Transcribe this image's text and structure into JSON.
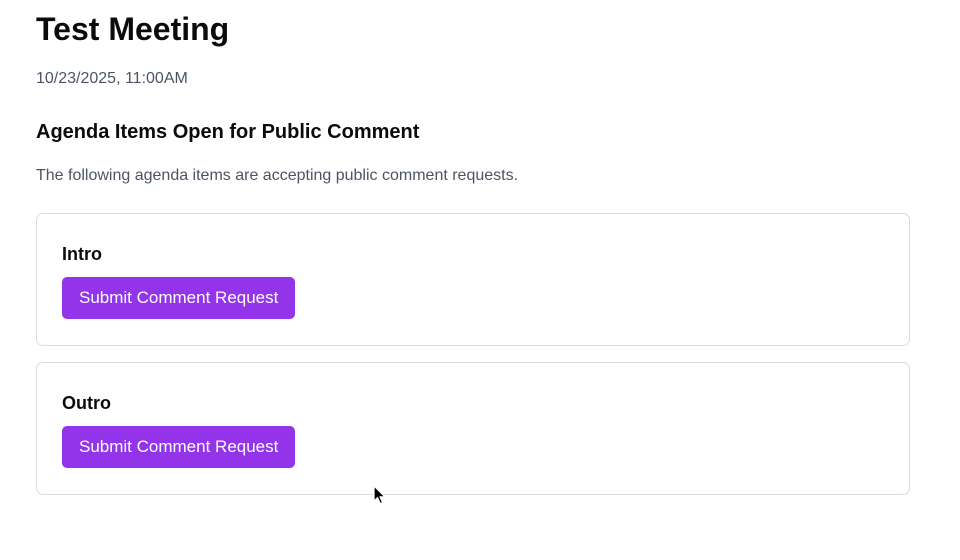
{
  "meeting": {
    "title": "Test Meeting",
    "datetime": "10/23/2025, 11:00AM"
  },
  "section": {
    "title": "Agenda Items Open for Public Comment",
    "description": "The following agenda items are accepting public comment requests."
  },
  "agenda_items": [
    {
      "name": "Intro",
      "button_label": "Submit Comment Request"
    },
    {
      "name": "Outro",
      "button_label": "Submit Comment Request"
    }
  ],
  "colors": {
    "accent": "#9333ea",
    "muted_text": "#4b5563",
    "card_border": "#d9dbe0"
  },
  "icons": {
    "cursor": "mouse-pointer-icon"
  }
}
